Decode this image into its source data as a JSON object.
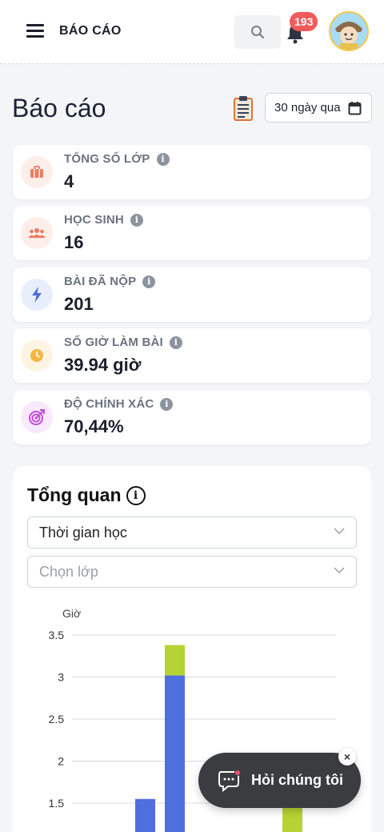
{
  "header": {
    "brand": "BÁO CÁO",
    "notification_count": "193"
  },
  "page": {
    "title": "Báo cáo",
    "period": "30 ngày qua"
  },
  "stats": [
    {
      "label": "TỔNG SỐ LỚP",
      "value": "4",
      "icon": "briefcase-icon",
      "color": "#ef7b5f",
      "bg": "#fdeeea"
    },
    {
      "label": "HỌC SINH",
      "value": "16",
      "icon": "users-icon",
      "color": "#ef7b5f",
      "bg": "#fdeeea"
    },
    {
      "label": "BÀI ĐÃ NỘP",
      "value": "201",
      "icon": "bolt-icon",
      "color": "#4a6fdc",
      "bg": "#e9eefc"
    },
    {
      "label": "SỐ GIỜ LÀM BÀI",
      "value": "39.94 giờ",
      "icon": "clock-icon",
      "color": "#f5b63f",
      "bg": "#fdf4e3"
    },
    {
      "label": "ĐỘ CHÍNH XÁC",
      "value": "70,44%",
      "icon": "target-icon",
      "color": "#c24fd9",
      "bg": "#f9e9fc"
    }
  ],
  "overview": {
    "title": "Tổng quan",
    "metric_select": "Thời gian học",
    "class_select_placeholder": "Chọn lớp"
  },
  "chart_data": {
    "type": "bar",
    "ylabel": "Giờ",
    "ylim": [
      1.2,
      3.6
    ],
    "yticks": [
      "3.5",
      "3",
      "2.5",
      "2",
      "1.5"
    ],
    "series_colors": [
      "#4f6fdf",
      "#b5d334"
    ],
    "bars": [
      {
        "segments": [
          1.55,
          0
        ]
      },
      {
        "segments": [
          3.02,
          0.36
        ]
      },
      {
        "segments": [
          0,
          0
        ]
      },
      {
        "segments": [
          0,
          0
        ]
      },
      {
        "segments": [
          0,
          1.5
        ]
      }
    ]
  },
  "chat": {
    "label": "Hỏi chúng tôi",
    "close": "×"
  }
}
